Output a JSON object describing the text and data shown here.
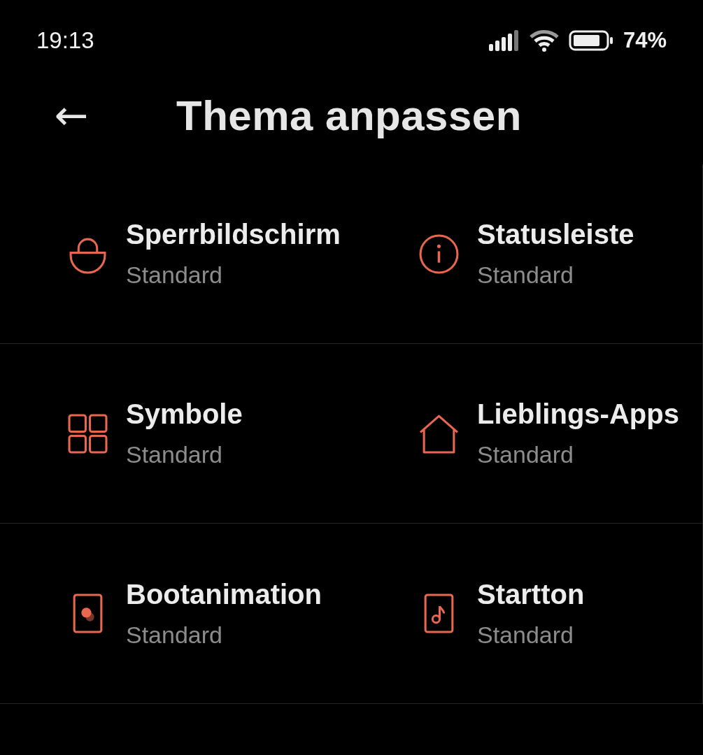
{
  "status_bar": {
    "time": "19:13",
    "battery": "74%"
  },
  "header": {
    "back": "←",
    "title": "Thema anpassen"
  },
  "items": [
    {
      "title": "Sperrbildschirm",
      "value": "Standard"
    },
    {
      "title": "Statusleiste",
      "value": "Standard"
    },
    {
      "title": "Symbole",
      "value": "Standard"
    },
    {
      "title": "Lieblings-Apps",
      "value": "Standard"
    },
    {
      "title": "Bootanimation",
      "value": "Standard"
    },
    {
      "title": "Startton",
      "value": "Standard"
    }
  ]
}
